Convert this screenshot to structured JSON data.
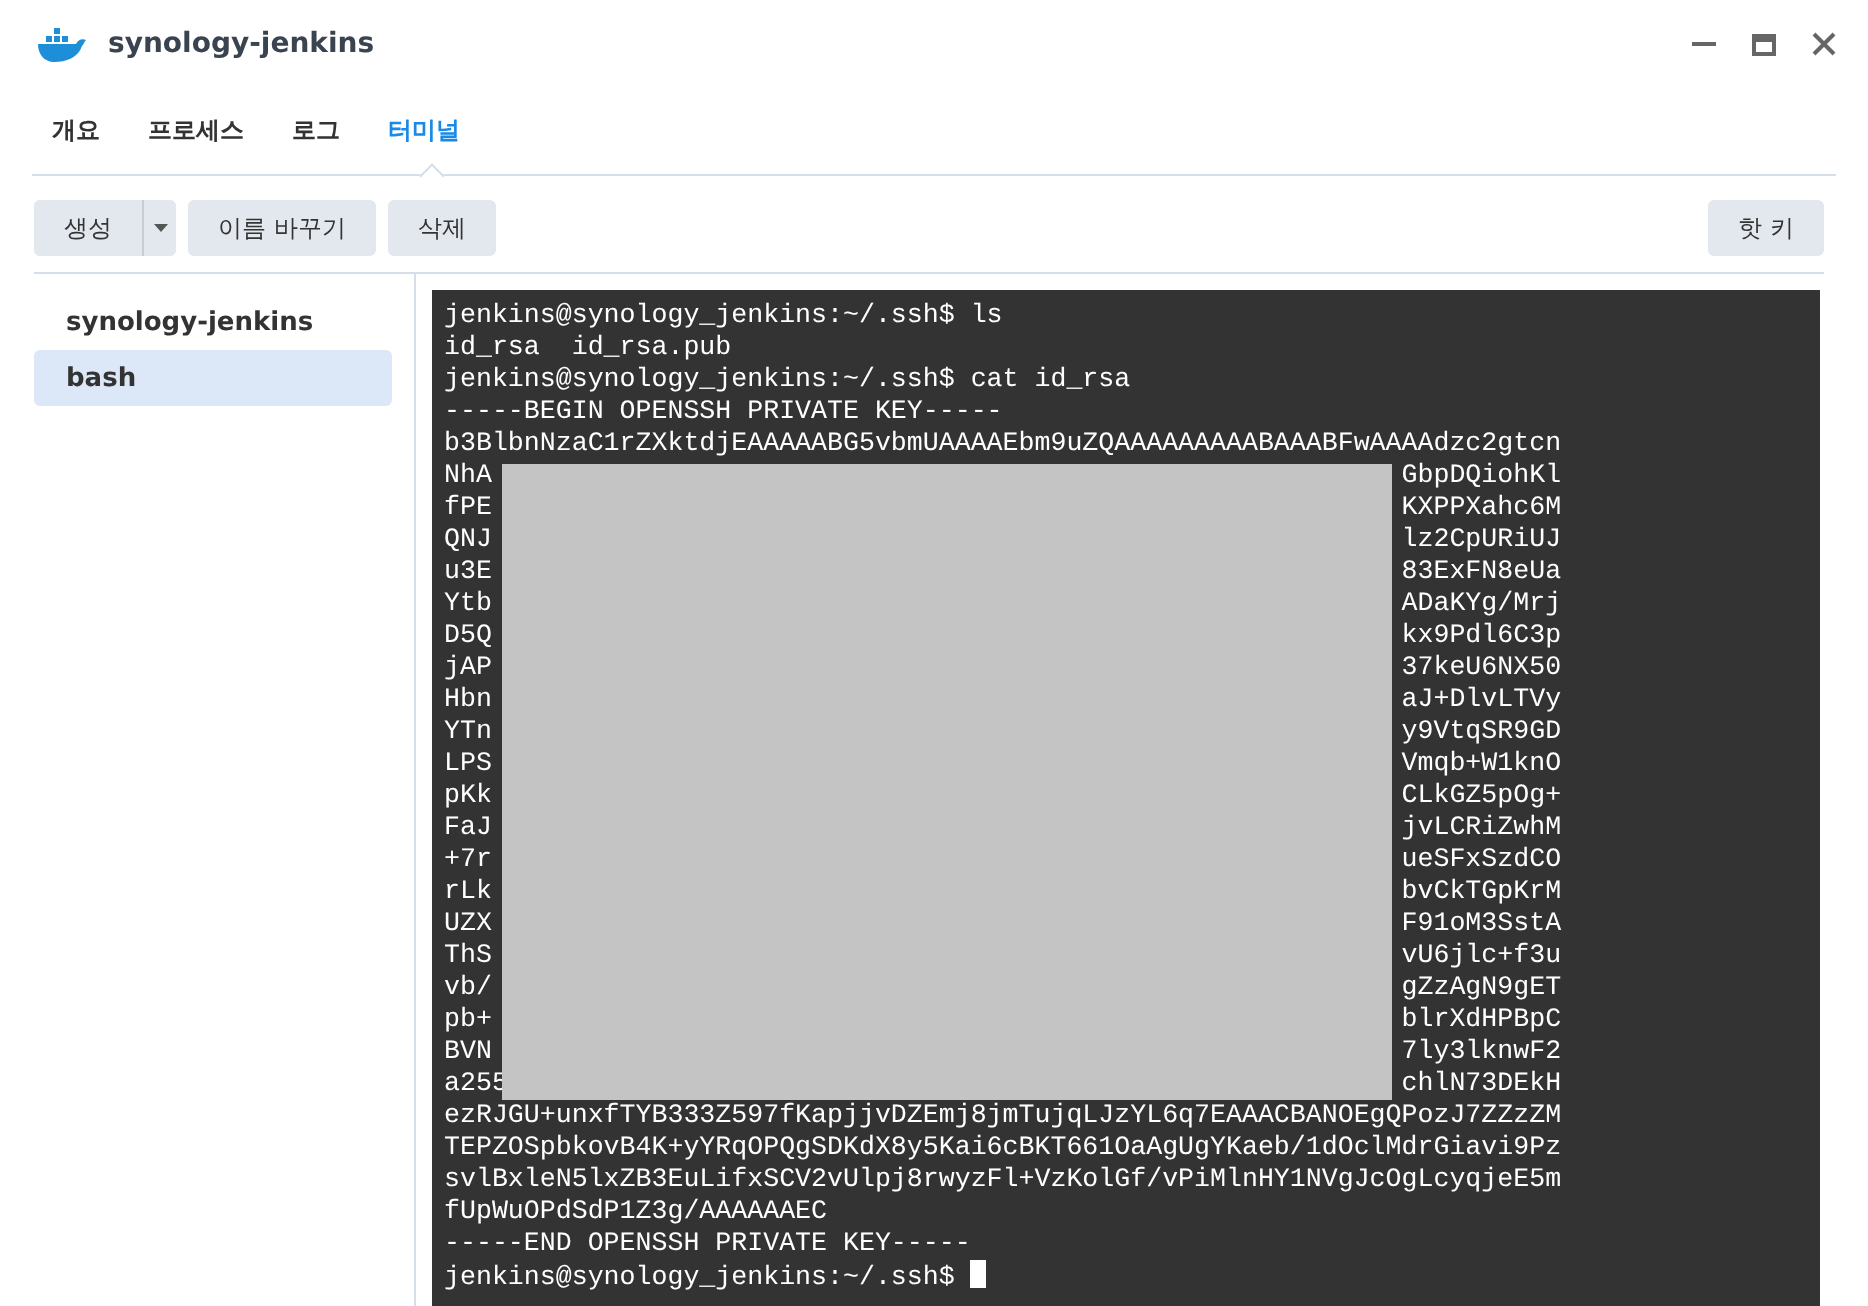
{
  "window": {
    "title": "synology-jenkins"
  },
  "tabs": [
    {
      "label": "개요",
      "selected": false
    },
    {
      "label": "프로세스",
      "selected": false
    },
    {
      "label": "로그",
      "selected": false
    },
    {
      "label": "터미널",
      "selected": true
    }
  ],
  "toolbar": {
    "create": "생성",
    "rename": "이름 바꾸기",
    "delete": "삭제",
    "hotkey": "핫 키"
  },
  "sessions": [
    {
      "label": "synology-jenkins",
      "selected": false
    },
    {
      "label": "bash",
      "selected": true
    }
  ],
  "terminal": {
    "lines_before": [
      "jenkins@synology_jenkins:~/.ssh$ ls",
      "id_rsa  id_rsa.pub",
      "jenkins@synology_jenkins:~/.ssh$ cat id_rsa",
      "-----BEGIN OPENSSH PRIVATE KEY-----",
      "b3BlbnNzaC1rZXktdjEAAAAABG5vbmUAAAAEbm9uZQAAAAAAAAABAAABFwAAAAdzc2gtcn"
    ],
    "covered_lines": [
      {
        "left": "NhA",
        "right": "GbpDQiohKl"
      },
      {
        "left": "fPE",
        "right": "KXPPXahc6M"
      },
      {
        "left": "QNJ",
        "right": "lz2CpURiUJ"
      },
      {
        "left": "u3E",
        "right": "83ExFN8eUa"
      },
      {
        "left": "Ytb",
        "right": "ADaKYg/Mrj"
      },
      {
        "left": "D5Q",
        "right": "kx9Pdl6C3p"
      },
      {
        "left": "jAP",
        "right": "37keU6NX50"
      },
      {
        "left": "Hbn",
        "right": "aJ+DlvLTVy"
      },
      {
        "left": "YTn",
        "right": "y9VtqSR9GD"
      },
      {
        "left": "LPS",
        "right": "Vmqb+W1knO"
      },
      {
        "left": "pKk",
        "right": "CLkGZ5pOg+"
      },
      {
        "left": "FaJ",
        "right": "jvLCRiZwhM"
      },
      {
        "left": "+7r",
        "right": "ueSFxSzdCO"
      },
      {
        "left": "rLk",
        "right": "bvCkTGpKrM"
      },
      {
        "left": "UZX",
        "right": "F91oM3SstA"
      },
      {
        "left": "ThS",
        "right": "vU6jlc+f3u"
      },
      {
        "left": "vb/",
        "right": "gZzAgN9gET"
      },
      {
        "left": "pb+",
        "right": "blrXdHPBpC"
      },
      {
        "left": "BVN",
        "right": "7ly3lknwF2"
      },
      {
        "left": "a255",
        "right": "chlN73DEkH"
      }
    ],
    "lines_after": [
      "ezRJGU+unxfTYB333Z597fKapjjvDZEmj8jmTujqLJzYL6q7EAAACBANOEgQPozJ7ZZzZM",
      "TEPZOSpbkovB4K+yYRqOPQgSDKdX8y5Kai6cBKT661OaAgUgYKaeb/1dOclMdrGiavi9Pz",
      "svlBxleN5lxZB3EuLifxSCV2vUlpj8rwyzFl+VzKolGf/vPiMlnHY1NVgJcOgLcyqjeE5m",
      "fUpWuOPdSdP1Z3g/AAAAAAEC",
      "-----END OPENSSH PRIVATE KEY-----"
    ],
    "prompt": "jenkins@synology_jenkins:~/.ssh$"
  }
}
